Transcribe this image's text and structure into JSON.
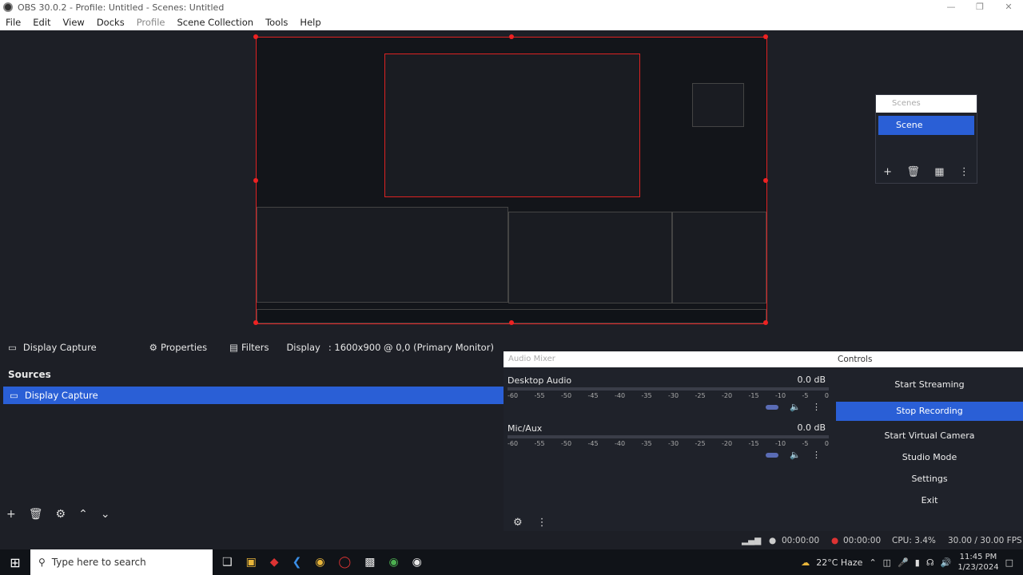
{
  "window": {
    "title": "OBS 30.0.2 - Profile: Untitled - Scenes: Untitled",
    "controls": [
      "—",
      "❐",
      "✕"
    ]
  },
  "menu": {
    "items": [
      "File",
      "Edit",
      "View",
      "Docks",
      "Profile",
      "Scene Collection",
      "Tools",
      "Help"
    ]
  },
  "scenes": {
    "header": "Scenes",
    "items": [
      "Scene"
    ]
  },
  "context_bar": {
    "source_name": "Display Capture",
    "properties_label": "Properties",
    "filters_label": "Filters",
    "display_label": "Display",
    "display_value": ": 1600x900 @ 0,0 (Primary Monitor)"
  },
  "sources": {
    "header": "Sources",
    "items": [
      "Display Capture"
    ]
  },
  "audio_mixer": {
    "header": "Audio Mixer",
    "ticks": [
      "-60",
      "-55",
      "-50",
      "-45",
      "-40",
      "-35",
      "-30",
      "-25",
      "-20",
      "-15",
      "-10",
      "-5",
      "0"
    ],
    "channels": [
      {
        "name": "Desktop Audio",
        "db": "0.0 dB"
      },
      {
        "name": "Mic/Aux",
        "db": "0.0 dB"
      }
    ]
  },
  "controls": {
    "header": "Controls",
    "buttons": [
      "Start Streaming",
      "Stop Recording",
      "Start Virtual Camera",
      "Studio Mode",
      "Settings",
      "Exit"
    ]
  },
  "status": {
    "stream_time": "00:00:00",
    "rec_time": "00:00:00",
    "cpu": "CPU: 3.4%",
    "fps": "30.00 / 30.00 FPS"
  },
  "taskbar": {
    "search_placeholder": "Type here to search",
    "weather": "22°C  Haze",
    "time": "11:45 PM",
    "date": "1/23/2024"
  },
  "colors": {
    "accent": "#2a5fd6",
    "canvas_border": "#dd2222",
    "rec_red": "#d33333"
  }
}
